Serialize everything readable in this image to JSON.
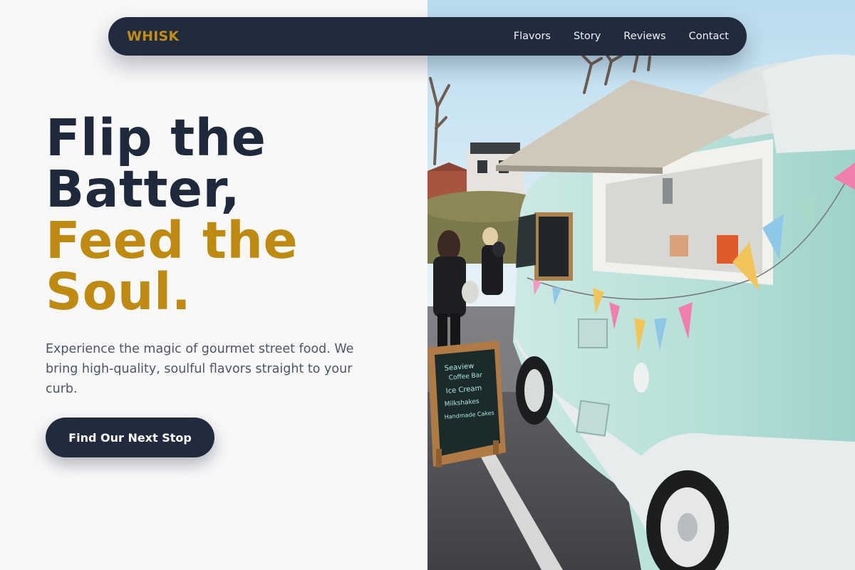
{
  "brand": {
    "name": "WHISK",
    "accent": "#bf8a12",
    "dark": "#222b3d"
  },
  "nav": {
    "links": [
      {
        "label": "Flavors"
      },
      {
        "label": "Story"
      },
      {
        "label": "Reviews"
      },
      {
        "label": "Contact"
      }
    ]
  },
  "hero": {
    "headline_line1": "Flip the",
    "headline_line2": "Batter,",
    "headline_line3": "Feed the",
    "headline_line4": "Soul.",
    "subtext": "Experience the magic of gourmet street food. We bring high-quality, soulful flavors straight to your curb.",
    "cta_label": "Find Our Next Stop"
  },
  "photo": {
    "subject": "mint vintage food truck with bunting and chalkboard sign",
    "menu_sign": {
      "lines": [
        "Seaview",
        "Coffee Bar",
        "Ice Cream",
        "Milkshakes",
        "Handmade Cakes"
      ]
    }
  }
}
